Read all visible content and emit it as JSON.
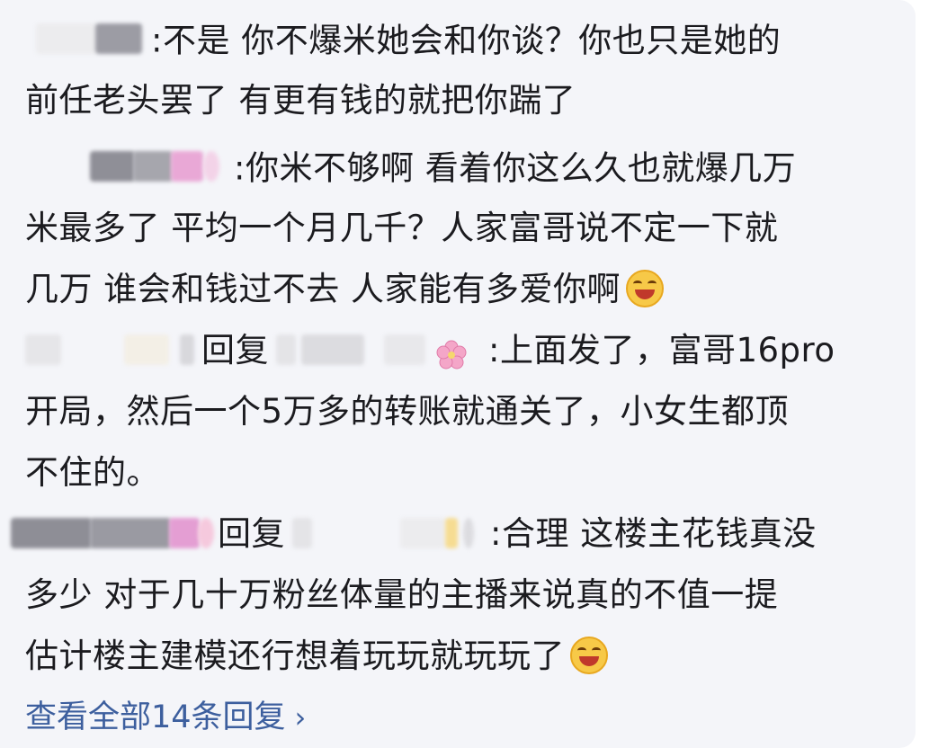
{
  "replies": [
    {
      "user": "",
      "lines": [
        ":不是 你不爆米她会和你谈？你也只是她的",
        "前任老头罢了 有更有钱的就把你踹了"
      ]
    },
    {
      "user": "",
      "lines": [
        ":你米不够啊 看着你这么久也就爆几万",
        "米最多了 平均一个月几千？人家富哥说不定一下就",
        "几万 谁会和钱过不去 人家能有多爱你啊"
      ],
      "trailing_emoji": "laughing-emoji"
    },
    {
      "user": "",
      "reply_word": "回复",
      "reply_to": "",
      "lines": [
        ":上面发了，富哥16pro",
        "开局，然后一个5万多的转账就通关了，小女生都顶",
        "不住的。"
      ]
    },
    {
      "user": "",
      "reply_word": "回复",
      "reply_to": "",
      "lines": [
        ":合理 这楼主花钱真没",
        "多少 对于几十万粉丝体量的主播来说真的不值一提",
        "估计楼主建模还行想着玩玩就玩玩了"
      ],
      "trailing_emoji": "laughing-emoji"
    }
  ],
  "view_all": "查看全部14条回复",
  "view_all_chevron": "›",
  "colors": {
    "panel_bg": "#f4f5f9",
    "text": "#1b1b1f",
    "link": "#3d5f9e"
  }
}
